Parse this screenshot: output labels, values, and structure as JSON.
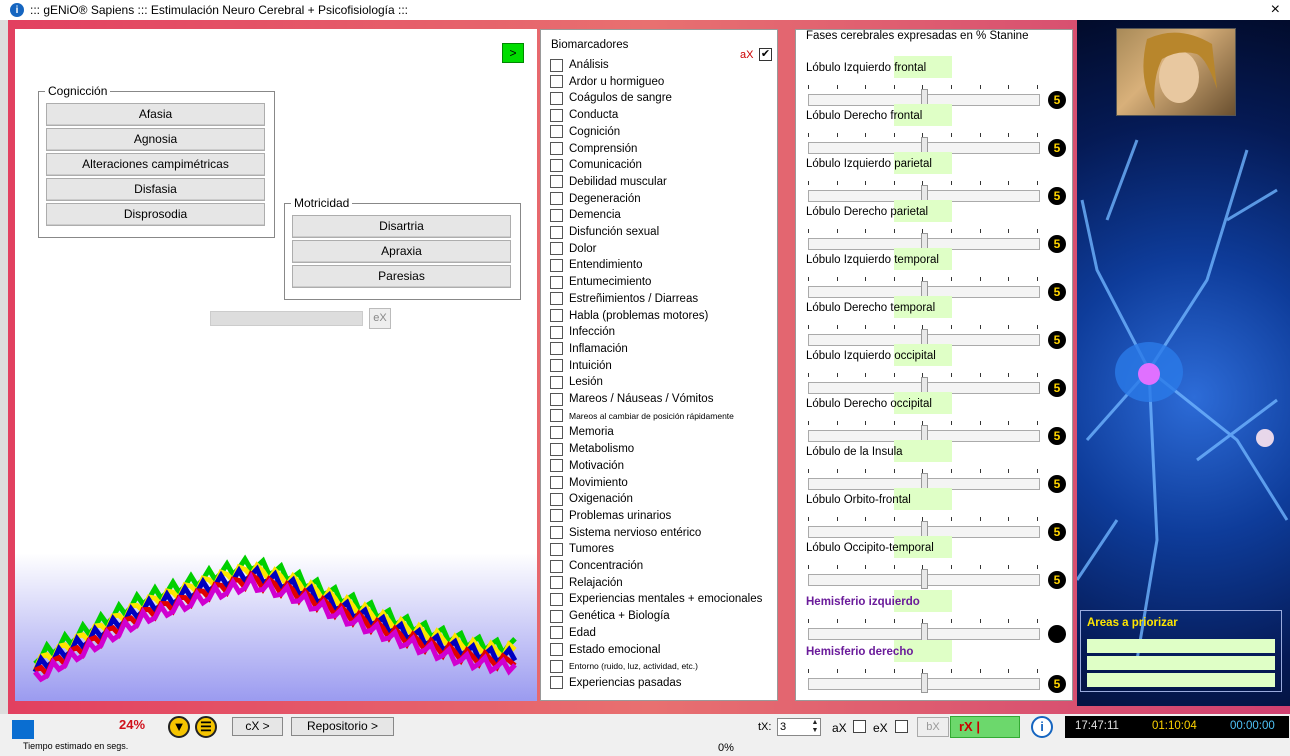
{
  "window": {
    "title": "::: gENiO® Sapiens ::: Estimulación Neuro Cerebral + Psicofisiología :::",
    "close": "×",
    "info_icon": "i"
  },
  "left": {
    "next_button": ">",
    "cognicion": {
      "legend": "Cognicción",
      "buttons": [
        "Afasia",
        "Agnosia",
        "Alteraciones campimétricas",
        "Disfasia",
        "Disprosodia"
      ]
    },
    "motricidad": {
      "legend": "Motricidad",
      "buttons": [
        "Disartria",
        "Apraxia",
        "Paresias"
      ]
    },
    "ex_button": "eX"
  },
  "biomarcadores": {
    "legend": "Biomarcadores",
    "ax_label": "aX",
    "ax_checked": "✔",
    "items": [
      "Análisis",
      "Ardor u hormigueo",
      "Coágulos de sangre",
      "Conducta",
      "Cognición",
      "Comprensión",
      "Comunicación",
      "Debilidad muscular",
      "Degeneración",
      "Demencia",
      "Disfunción sexual",
      "Dolor",
      "Entendimiento",
      "Entumecimiento",
      "Estreñimientos / Diarreas",
      "Habla (problemas motores)",
      "Infección",
      "Inflamación",
      "Intuición",
      "Lesión",
      "Mareos / Náuseas / Vómitos",
      "Mareos al cambiar de posición rápidamente",
      "Memoria",
      "Metabolismo",
      "Motivación",
      "Movimiento",
      "Oxigenación",
      "Problemas urinarios",
      "Sistema nervioso entérico",
      "Tumores",
      "Concentración",
      "Relajación",
      "Experiencias mentales + emocionales",
      "Genética + Biología",
      "Edad",
      "Estado emocional",
      "Entorno (ruido, luz, actividad, etc.)",
      "Experiencias pasadas"
    ]
  },
  "fases": {
    "legend": "Fases cerebrales expresadas en % Stanine",
    "lobes": [
      {
        "name": "Lóbulo Izquierdo frontal",
        "value": "5",
        "level": 0.5
      },
      {
        "name": "Lóbulo Derecho frontal",
        "value": "5",
        "level": 0.5
      },
      {
        "name": "Lóbulo Izquierdo parietal",
        "value": "5",
        "level": 0.5
      },
      {
        "name": "Lóbulo Derecho parietal",
        "value": "5",
        "level": 0.5
      },
      {
        "name": "Lóbulo Izquierdo temporal",
        "value": "5",
        "level": 0.5
      },
      {
        "name": "Lóbulo Derecho temporal",
        "value": "5",
        "level": 0.5
      },
      {
        "name": "Lóbulo Izquierdo occipital",
        "value": "5",
        "level": 0.5
      },
      {
        "name": "Lóbulo Derecho occipital",
        "value": "5",
        "level": 0.5
      },
      {
        "name": "Lóbulo de la Insula",
        "value": "5",
        "level": 0.5
      },
      {
        "name": "Lóbulo Orbito-frontal",
        "value": "5",
        "level": 0.5
      },
      {
        "name": "Lóbulo Occipito-temporal",
        "value": "5",
        "level": 0.5
      },
      {
        "name": "Hemisferio izquierdo",
        "value": "",
        "level": 0.5,
        "hemi": true
      },
      {
        "name": "Hemisferio derecho",
        "value": "5",
        "level": 0.5,
        "hemi": true
      }
    ]
  },
  "side": {
    "areas_title": "Areas a priorizar"
  },
  "status": {
    "percent": "24%",
    "down_icon": "▼",
    "menu_icon": "☰",
    "cx_button": "cX >",
    "repo_button": "Repositorio >",
    "tiempo": "Tiempo estimado en segs.",
    "progress_pct": "0%",
    "tx_label": "tX:",
    "tx_value": "3",
    "ax_label": "aX",
    "ex_label": "eX",
    "bx_button": "bX",
    "rx_button": "rX |",
    "info": "i",
    "clock1": "17:47:11",
    "clock2": "01:10:04",
    "clock3": "00:00:00",
    "colors": {
      "clock1": "#e0e0e0",
      "clock2": "#ffd400",
      "clock3": "#4fc3f7"
    }
  }
}
